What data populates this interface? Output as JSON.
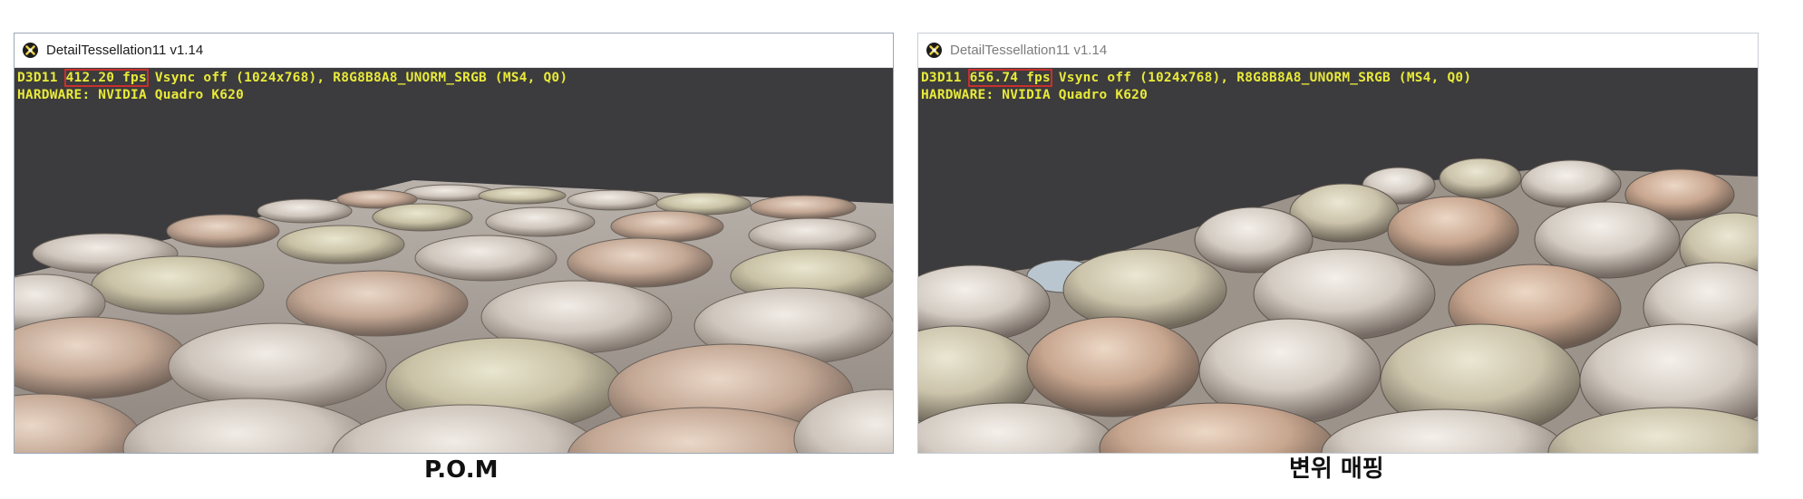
{
  "left_window": {
    "title": "DetailTessellation11 v1.14",
    "hud_prefix": "D3D11 ",
    "fps": "412.20 fps",
    "hud_suffix": " Vsync off (1024x768), R8G8B8A8_UNORM_SRGB (MS4, Q0)",
    "hud_line2": "HARDWARE: NVIDIA Quadro K620",
    "caption": "P.O.M"
  },
  "right_window": {
    "title": "DetailTessellation11 v1.14",
    "hud_prefix": "D3D11 ",
    "fps": "656.74 fps",
    "hud_suffix": " Vsync off (1024x768), R8G8B8A8_UNORM_SRGB (MS4, Q0)",
    "hud_line2": "HARDWARE: NVIDIA Quadro K620",
    "caption": "변위 매핑"
  },
  "colors": {
    "hud_text": "#e8ea3a",
    "fps_highlight": "#c9302c",
    "viewport_bg": "#3c3b3d"
  },
  "icons": [
    "directx-app-icon"
  ]
}
